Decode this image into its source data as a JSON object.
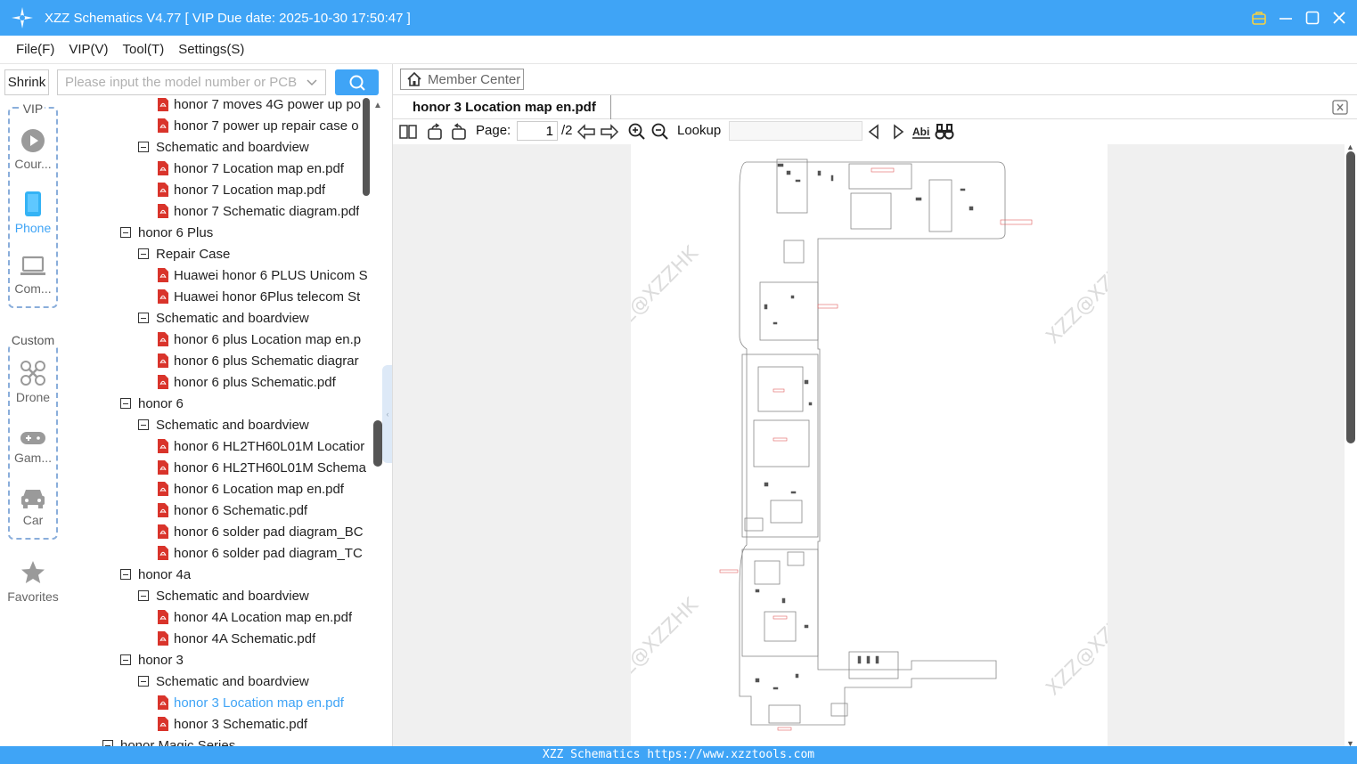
{
  "app": {
    "title": "XZZ Schematics V4.77 [ VIP Due date: 2025-10-30 17:50:47 ]",
    "accent_color": "#3fa4f6"
  },
  "menu": [
    "File(F)",
    "VIP(V)",
    "Tool(T)",
    "Settings(S)"
  ],
  "search": {
    "shrink_label": "Shrink",
    "placeholder": "Please input the model number or PCB",
    "value": ""
  },
  "rail": {
    "vip_title": "VIP",
    "custom_title": "Custom",
    "items": [
      {
        "label": "Cour...",
        "icon": "play-circle-icon"
      },
      {
        "label": "Phone",
        "icon": "phone-icon",
        "active": true
      },
      {
        "label": "Com...",
        "icon": "laptop-icon"
      },
      {
        "label": "Drone",
        "icon": "drone-icon"
      },
      {
        "label": "Gam...",
        "icon": "gamepad-icon"
      },
      {
        "label": "Car",
        "icon": "car-icon"
      },
      {
        "label": "Favorites",
        "icon": "star-icon"
      }
    ]
  },
  "tree": [
    {
      "label": "honor 7 moves 4G power up po",
      "type": "pdf"
    },
    {
      "label": "honor 7 power up repair case o",
      "type": "pdf"
    },
    {
      "label": "Schematic and boardview",
      "type": "folder"
    },
    {
      "label": "honor 7 Location map en.pdf",
      "type": "pdf"
    },
    {
      "label": "honor 7 Location map.pdf",
      "type": "pdf"
    },
    {
      "label": "honor 7 Schematic diagram.pdf",
      "type": "pdf"
    },
    {
      "label": "honor 6 Plus",
      "type": "model"
    },
    {
      "label": "Repair Case",
      "type": "folder"
    },
    {
      "label": "Huawei honor 6 PLUS Unicom S",
      "type": "pdf"
    },
    {
      "label": "Huawei honor 6Plus telecom St",
      "type": "pdf"
    },
    {
      "label": "Schematic and boardview",
      "type": "folder"
    },
    {
      "label": "honor 6 plus Location map en.p",
      "type": "pdf"
    },
    {
      "label": "honor 6 plus Schematic diagrar",
      "type": "pdf"
    },
    {
      "label": "honor 6 plus Schematic.pdf",
      "type": "pdf"
    },
    {
      "label": "honor 6",
      "type": "model"
    },
    {
      "label": "Schematic and boardview",
      "type": "folder"
    },
    {
      "label": "honor 6 HL2TH60L01M Locatior",
      "type": "pdf"
    },
    {
      "label": "honor 6 HL2TH60L01M Schema",
      "type": "pdf"
    },
    {
      "label": "honor 6 Location map en.pdf",
      "type": "pdf"
    },
    {
      "label": "honor 6 Schematic.pdf",
      "type": "pdf"
    },
    {
      "label": "honor 6 solder pad diagram_BC",
      "type": "pdf"
    },
    {
      "label": "honor 6 solder pad diagram_TC",
      "type": "pdf"
    },
    {
      "label": "honor 4a",
      "type": "model"
    },
    {
      "label": "Schematic and boardview",
      "type": "folder"
    },
    {
      "label": "honor 4A Location map en.pdf",
      "type": "pdf"
    },
    {
      "label": "honor 4A Schematic.pdf",
      "type": "pdf"
    },
    {
      "label": "honor 3",
      "type": "model"
    },
    {
      "label": "Schematic and boardview",
      "type": "folder"
    },
    {
      "label": "honor 3 Location map en.pdf",
      "type": "pdf",
      "selected": true
    },
    {
      "label": "honor 3 Schematic.pdf",
      "type": "pdf"
    },
    {
      "label": "honor Magic Series",
      "type": "series"
    }
  ],
  "viewer": {
    "member_center": "Member Center",
    "tab_title": "honor 3 Location map en.pdf",
    "page_label": "Page:",
    "page_current": "1",
    "page_total": "/2",
    "lookup_label": "Lookup",
    "lookup_value": "",
    "watermark": "XZZ@XZZHK"
  },
  "status": {
    "text": "XZZ Schematics https://www.xzztools.com"
  }
}
